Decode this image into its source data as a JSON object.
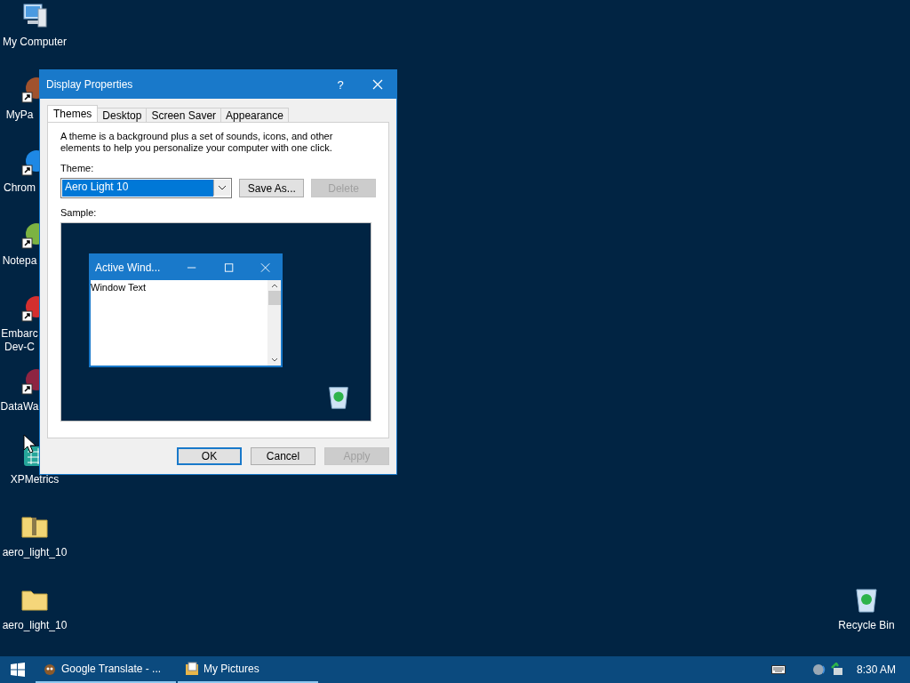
{
  "desktop": {
    "icons": [
      {
        "kind": "computer",
        "lines": [
          "My Computer"
        ]
      },
      {
        "kind": "shortcut",
        "color": "#a0522d",
        "lines": [
          "MyPa"
        ]
      },
      {
        "kind": "shortcut",
        "color": "#1e88e5",
        "lines": [
          "Chrom"
        ]
      },
      {
        "kind": "shortcut",
        "color": "#7cb342",
        "lines": [
          "Notepa"
        ]
      },
      {
        "kind": "shortcut",
        "color": "#d32f2f",
        "lines": [
          "Embarc",
          "Dev-C"
        ]
      },
      {
        "kind": "shortcut",
        "color": "#8e2442",
        "lines": [
          "DataWa"
        ]
      },
      {
        "kind": "app",
        "color": "#26a69a",
        "lines": [
          "XPMetrics"
        ]
      },
      {
        "kind": "zip",
        "lines": [
          "aero_light_10"
        ]
      },
      {
        "kind": "folder",
        "lines": [
          "aero_light_10"
        ]
      }
    ],
    "recycle_bin": {
      "label": "Recycle Bin"
    }
  },
  "dialog": {
    "title": "Display Properties",
    "help": "?",
    "tabs": [
      {
        "label": "Themes",
        "selected": true
      },
      {
        "label": "Desktop",
        "selected": false
      },
      {
        "label": "Screen Saver",
        "selected": false
      },
      {
        "label": "Appearance",
        "selected": false
      }
    ],
    "description": "A theme is a background plus a set of sounds, icons, and other elements to help you personalize your computer with one click.",
    "theme_label": "Theme:",
    "theme_value": "Aero Light 10",
    "side_buttons": [
      {
        "label": "Save As...",
        "disabled": false
      },
      {
        "label": "Delete",
        "disabled": true
      }
    ],
    "sample_label": "Sample:",
    "sample": {
      "window_title": "Active Wind...",
      "window_text": "Window Text"
    },
    "buttons": [
      {
        "label": "OK",
        "default": true,
        "disabled": false
      },
      {
        "label": "Cancel",
        "default": false,
        "disabled": false
      },
      {
        "label": "Apply",
        "default": false,
        "disabled": true
      }
    ]
  },
  "taskbar": {
    "tasks": [
      {
        "label": "Google Translate - ...",
        "kind": "browser"
      },
      {
        "label": "My Pictures",
        "kind": "pictures"
      }
    ],
    "clock": "8:30 AM"
  }
}
